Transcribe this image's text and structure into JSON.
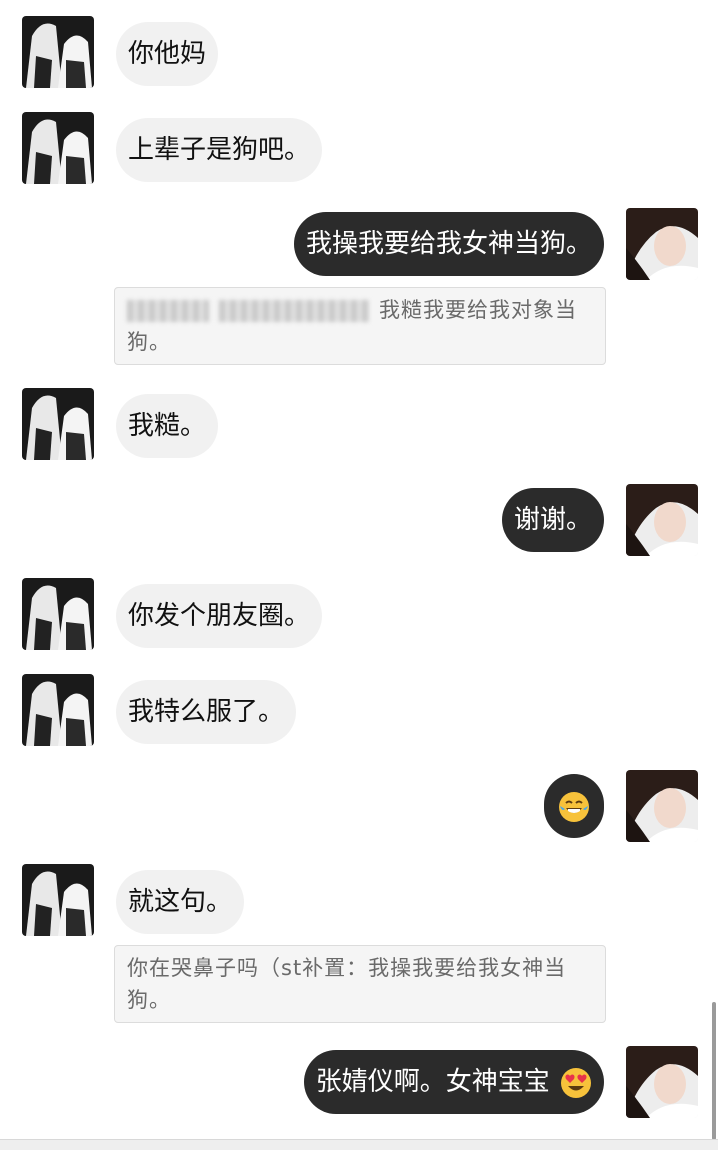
{
  "messages": [
    {
      "side": "in",
      "text": "你他妈"
    },
    {
      "side": "in",
      "text": "上辈子是狗吧。"
    },
    {
      "side": "out",
      "text": "我操我要给我女神当狗。"
    },
    {
      "side": "quote",
      "text": "我糙我要给我对象当狗。"
    },
    {
      "side": "in",
      "text": "我糙。"
    },
    {
      "side": "out",
      "text": "谢谢。"
    },
    {
      "side": "in",
      "text": "你发个朋友圈。"
    },
    {
      "side": "in",
      "text": "我特么服了。"
    },
    {
      "side": "out",
      "text": "",
      "emoji": "tears-of-joy-emoji"
    },
    {
      "side": "in",
      "text": "就这句。"
    },
    {
      "side": "quote",
      "text": "你在哭鼻子吗（st补置：我操我要给我女神当狗。"
    },
    {
      "side": "out",
      "text": "张婧仪啊。女神宝宝",
      "emoji": "heart-eyes-emoji"
    }
  ],
  "avatars": {
    "left": "anime-avatar",
    "right": "girl-avatar"
  },
  "colors": {
    "incoming_bubble": "#f1f1f1",
    "outgoing_bubble": "#2b2b2b",
    "quote_bg": "#f5f5f5",
    "emoji_yellow": "#f7c23b"
  }
}
